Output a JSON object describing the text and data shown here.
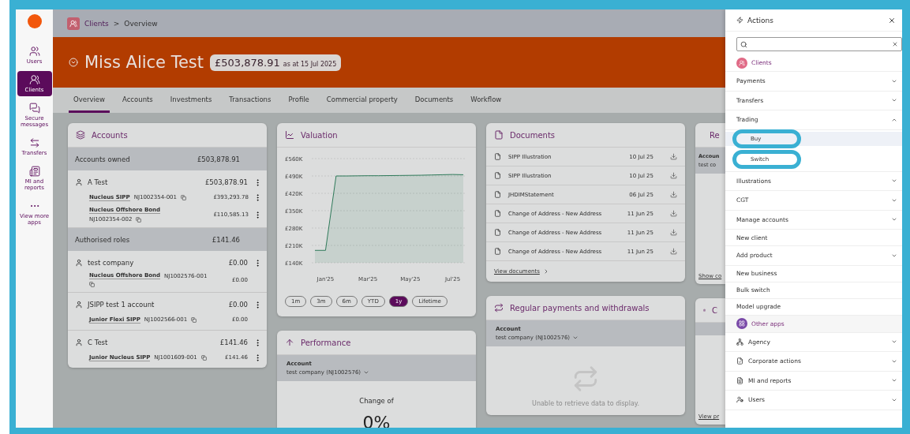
{
  "rail": {
    "items": [
      {
        "label": "Users",
        "selected": false
      },
      {
        "label": "Clients",
        "selected": true
      },
      {
        "label": "Secure messages",
        "selected": false
      },
      {
        "label": "Transfers",
        "selected": false
      },
      {
        "label": "MI and reports",
        "selected": false
      },
      {
        "label": "View more apps",
        "selected": false
      }
    ]
  },
  "breadcrumb": {
    "items": [
      "Clients",
      "Overview"
    ],
    "separator": ">"
  },
  "header": {
    "name": "Miss Alice Test",
    "balance": "£503,878.91",
    "as_of": "as at 15 Jul 2025"
  },
  "tabs": [
    {
      "label": "Overview",
      "selected": true
    },
    {
      "label": "Accounts",
      "selected": false
    },
    {
      "label": "Investments",
      "selected": false
    },
    {
      "label": "Transactions",
      "selected": false
    },
    {
      "label": "Profile",
      "selected": false
    },
    {
      "label": "Commercial property",
      "selected": false
    },
    {
      "label": "Documents",
      "selected": false
    },
    {
      "label": "Workflow",
      "selected": false
    }
  ],
  "accounts": {
    "title": "Accounts",
    "groups": [
      {
        "label": "Accounts owned",
        "total": "£503,878.91",
        "holders": [
          {
            "name": "A Test",
            "value": "£503,878.91",
            "menu": true,
            "products": [
              {
                "name": "Nucleus SIPP",
                "ref": "NJ1002354-001",
                "value": "£393,293.78",
                "menu": true
              },
              {
                "name": "Nucleus Offshore Bond",
                "ref": "NJ1002354-002",
                "value": "£110,585.13",
                "menu": true
              }
            ]
          }
        ]
      },
      {
        "label": "Authorised roles",
        "total": "£141.46",
        "holders": [
          {
            "name": "test company",
            "value": "£0.00",
            "menu": true,
            "products": [
              {
                "name": "Nucleus Offshore Bond",
                "ref": "NJ1002576-001",
                "value": "£0.00",
                "menu": false
              }
            ]
          },
          {
            "name": "JSIPP test 1 account",
            "value": "£0.00",
            "menu": true,
            "products": [
              {
                "name": "Junior Flexi SIPP",
                "ref": "NJ1002566-001",
                "value": "£0.00",
                "menu": false
              }
            ]
          },
          {
            "name": "C Test",
            "value": "£141.46",
            "menu": true,
            "products": [
              {
                "name": "Junior Nucleus SIPP",
                "ref": "NJ1001609-001",
                "value": "£141.46",
                "menu": true
              }
            ]
          }
        ]
      }
    ]
  },
  "valuation": {
    "title": "Valuation",
    "chart_data": {
      "type": "area",
      "grid": true,
      "categories": [
        null,
        "Jan'25",
        null,
        null,
        null,
        "Mar'25",
        null,
        null,
        null,
        "May'25",
        null,
        null,
        null,
        "Jul'25",
        null
      ],
      "series": [
        {
          "color": "#2f7a5a",
          "values": [
            190000,
            190000,
            490000,
            490000,
            490500,
            491000,
            491000,
            491500,
            492000,
            492500,
            493000,
            494000,
            495000,
            496000,
            495000
          ]
        }
      ],
      "ylim": [
        140000,
        560000
      ],
      "yticks": [
        {
          "value": 140000,
          "label": "£140K"
        },
        {
          "value": 210000,
          "label": "£210K"
        },
        {
          "value": 280000,
          "label": "£280K"
        },
        {
          "value": 350000,
          "label": "£350K"
        },
        {
          "value": 420000,
          "label": "£420K"
        },
        {
          "value": 490000,
          "label": "£490K"
        },
        {
          "value": 560000,
          "label": "£560K"
        }
      ]
    },
    "ranges": [
      {
        "label": "1m",
        "selected": false
      },
      {
        "label": "3m",
        "selected": false
      },
      {
        "label": "6m",
        "selected": false
      },
      {
        "label": "YTD",
        "selected": false
      },
      {
        "label": "1y",
        "selected": true
      },
      {
        "label": "Lifetime",
        "selected": false
      }
    ]
  },
  "performance": {
    "title": "Performance",
    "account_label": "Account",
    "account": "test company (NJ1002576)",
    "change_label": "Change of",
    "change": "0%"
  },
  "documents": {
    "title": "Documents",
    "items": [
      {
        "name": "SIPP Illustration",
        "date": "10 Jul 25"
      },
      {
        "name": "SIPP Illustration",
        "date": "10 Jul 25"
      },
      {
        "name": "JHDIMStatement",
        "date": "06 Jul 25"
      },
      {
        "name": "Change of Address - New Address",
        "date": "11 Jun 25"
      },
      {
        "name": "Change of Address - New Address",
        "date": "11 Jun 25"
      },
      {
        "name": "Change of Address - New Address",
        "date": "11 Jun 25"
      }
    ],
    "link": "View documents"
  },
  "regular": {
    "title": "Regular payments and withdrawals",
    "account_label": "Account",
    "account": "test company (NJ1002576)",
    "empty": "Unable to retrieve data to display."
  },
  "partial_cards": [
    {
      "title": "Re",
      "lines": [
        "Accoun",
        "test co"
      ],
      "link": "Show co"
    },
    {
      "title": "C",
      "link": "View pr"
    }
  ],
  "actions": {
    "title": "Actions",
    "sections": [
      {
        "label": "Clients",
        "kind": "clients",
        "items": [
          {
            "label": "Payments",
            "kind": "group",
            "expanded": false
          },
          {
            "label": "Transfers",
            "kind": "group",
            "expanded": false
          },
          {
            "label": "Trading",
            "kind": "group",
            "expanded": true,
            "children": [
              {
                "label": "Buy",
                "selected": true,
                "highlighted": true
              },
              {
                "label": "Switch",
                "selected": false,
                "highlighted": true
              }
            ]
          },
          {
            "label": "Illustrations",
            "kind": "group",
            "expanded": false
          },
          {
            "label": "CGT",
            "kind": "group",
            "expanded": false
          },
          {
            "label": "Manage accounts",
            "kind": "group",
            "expanded": false
          },
          {
            "label": "New client",
            "kind": "link"
          },
          {
            "label": "Add product",
            "kind": "group",
            "expanded": false
          },
          {
            "label": "New business",
            "kind": "link"
          },
          {
            "label": "Bulk switch",
            "kind": "link"
          },
          {
            "label": "Model upgrade",
            "kind": "link"
          }
        ]
      },
      {
        "label": "Other apps",
        "kind": "apps",
        "items": [
          {
            "label": "Agency",
            "kind": "group",
            "expanded": false
          },
          {
            "label": "Corporate actions",
            "kind": "group",
            "expanded": false
          },
          {
            "label": "MI and reports",
            "kind": "group",
            "expanded": false
          },
          {
            "label": "Users",
            "kind": "group",
            "expanded": false
          }
        ]
      }
    ]
  }
}
